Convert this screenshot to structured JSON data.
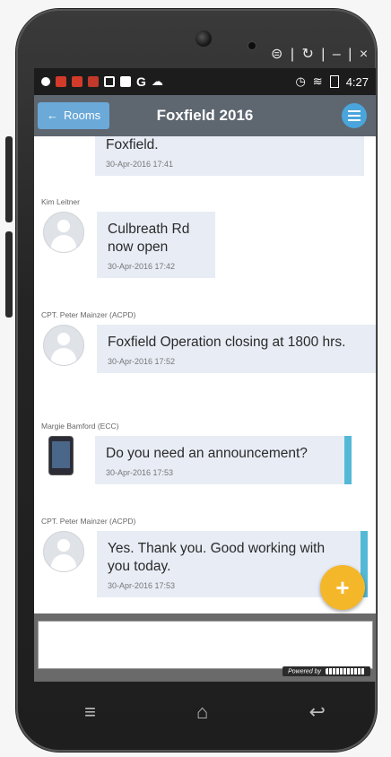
{
  "device": {
    "top_keys": "⊜ | ↻ | – | ×"
  },
  "status_bar": {
    "time": "4:27"
  },
  "app_bar": {
    "back_label": "Rooms",
    "title": "Foxfield 2016"
  },
  "messages": [
    {
      "sender": "",
      "text": "Foxfield.",
      "time": "30-Apr-2016 17:41",
      "avatar": "none",
      "teal": false
    },
    {
      "sender": "Kim Leitner",
      "text": "Culbreath Rd now open",
      "time": "30-Apr-2016 17:42",
      "avatar": "person",
      "teal": false
    },
    {
      "sender": "CPT. Peter Mainzer (ACPD)",
      "text": "Foxfield Operation closing at 1800 hrs.",
      "time": "30-Apr-2016 17:52",
      "avatar": "person",
      "teal": false
    },
    {
      "sender": "Margie Bamford (ECC)",
      "text": "Do you need an announcement?",
      "time": "30-Apr-2016 17:53",
      "avatar": "device",
      "teal": true
    },
    {
      "sender": "CPT. Peter Mainzer (ACPD)",
      "text": "Yes. Thank you. Good working with you today.",
      "time": "30-Apr-2016 17:53",
      "avatar": "person",
      "teal": true
    }
  ],
  "composer": {
    "powered_by": "Powered by"
  },
  "colors": {
    "app_bar": "#5e6670",
    "back_button": "#6aa9d8",
    "bubble": "#e8ecf5",
    "accent_bar": "#54b9d6",
    "fab": "#f5b72a"
  }
}
